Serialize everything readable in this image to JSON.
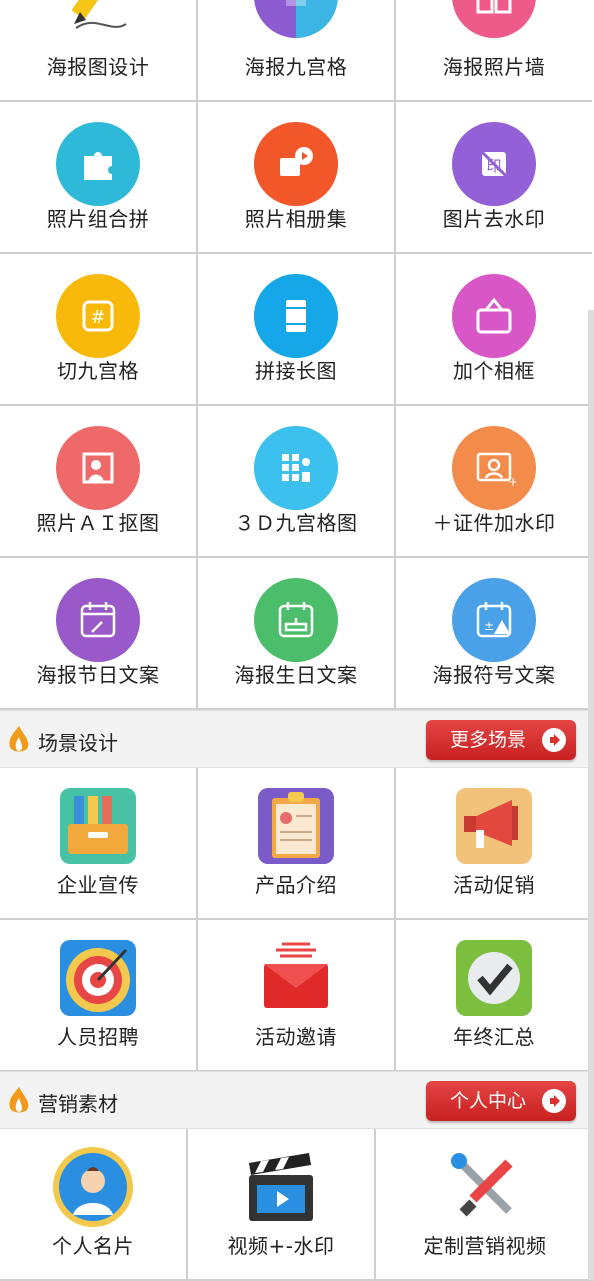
{
  "grid_top": [
    {
      "label": "海报图设计",
      "icon": "pencil-icon"
    },
    {
      "label": "海报九宫格",
      "icon": "puzzle-color-icon"
    },
    {
      "label": "海报照片墙",
      "icon": "photo-wall-icon"
    },
    {
      "label": "照片组合拼",
      "icon": "puzzle-icon"
    },
    {
      "label": "照片相册集",
      "icon": "album-icon"
    },
    {
      "label": "图片去水印",
      "icon": "remove-watermark-icon"
    },
    {
      "label": "切九宫格",
      "icon": "grid-hash-icon"
    },
    {
      "label": "拼接长图",
      "icon": "long-image-icon"
    },
    {
      "label": "加个相框",
      "icon": "frame-icon"
    },
    {
      "label": "照片ＡＩ抠图",
      "icon": "ai-cutout-icon"
    },
    {
      "label": "３Ｄ九宫格图",
      "icon": "3d-grid-icon"
    },
    {
      "label": "＋证件加水印",
      "icon": "id-watermark-icon"
    },
    {
      "label": "海报节日文案",
      "icon": "holiday-calendar-icon"
    },
    {
      "label": "海报生日文案",
      "icon": "birthday-calendar-icon"
    },
    {
      "label": "海报符号文案",
      "icon": "symbol-calendar-icon"
    }
  ],
  "section_scene": {
    "title": "场景设计",
    "more": "更多场景"
  },
  "grid_scene": [
    {
      "label": "企业宣传",
      "icon": "file-drawer-icon"
    },
    {
      "label": "产品介绍",
      "icon": "clipboard-icon"
    },
    {
      "label": "活动促销",
      "icon": "megaphone-icon"
    },
    {
      "label": "人员招聘",
      "icon": "target-icon"
    },
    {
      "label": "活动邀请",
      "icon": "envelope-icon"
    },
    {
      "label": "年终汇总",
      "icon": "checkmark-icon"
    }
  ],
  "section_market": {
    "title": "营销素材",
    "more": "个人中心"
  },
  "grid_market": [
    {
      "label": "个人名片",
      "icon": "person-card-icon"
    },
    {
      "label": "视频+-水印",
      "icon": "clapperboard-icon"
    },
    {
      "label": "定制营销视频",
      "icon": "tools-icon"
    }
  ],
  "colors": {
    "ic1": "#f5c518",
    "ic2": "#f0a030",
    "ic3": "#ee5a8a",
    "ic4": "#2fb9d8",
    "ic5": "#f2572a",
    "ic6": "#9360d8",
    "ic7": "#f9b90b",
    "ic8": "#16a7e8",
    "ic9": "#d857c6",
    "ic10": "#f0696a",
    "ic11": "#3cc0ee",
    "ic12": "#f38c4a",
    "ic13": "#9a59c9",
    "ic14": "#4cbd6a",
    "ic15": "#4aa1e8",
    "accent": "#d93030"
  }
}
